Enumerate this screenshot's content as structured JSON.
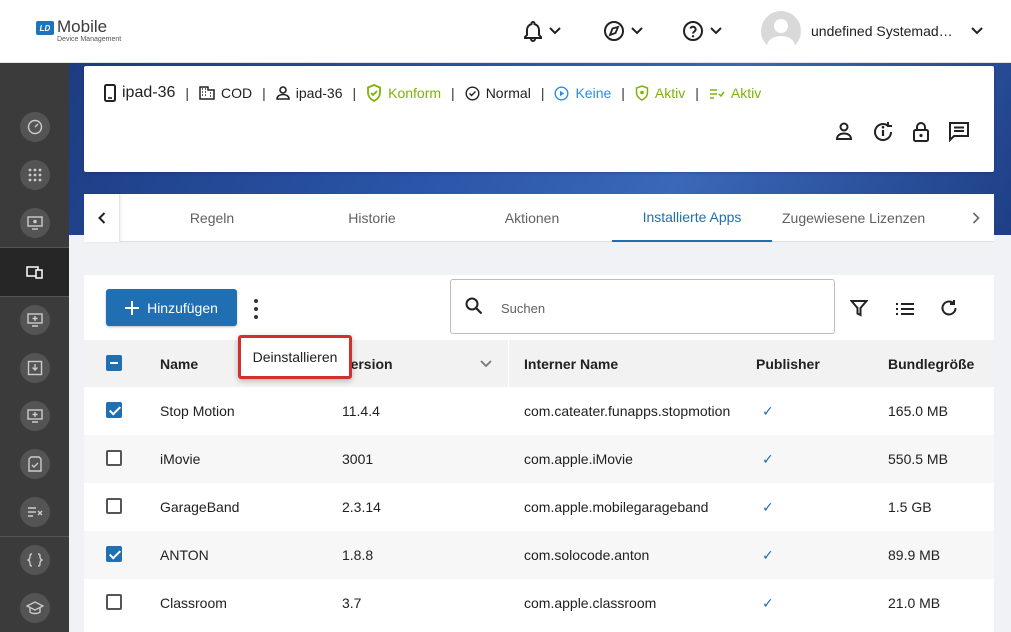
{
  "app": {
    "logo_badge": "LD",
    "logo_main": "Mobile",
    "logo_sub": "Device Management"
  },
  "header": {
    "user_name": "undefined Systemadmini",
    "icons": [
      "bell-icon",
      "compass-icon",
      "help-icon"
    ]
  },
  "device": {
    "name": "ipad-36",
    "location": "COD",
    "user": "ipad-36",
    "compliance": "Konform",
    "mode": "Normal",
    "action": "Keine",
    "security": "Aktiv",
    "policy": "Aktiv"
  },
  "tabs": [
    {
      "label": "Regeln"
    },
    {
      "label": "Historie"
    },
    {
      "label": "Aktionen"
    },
    {
      "label": "Installierte Apps"
    },
    {
      "label": "Zugewiesene Lizenzen"
    }
  ],
  "toolbar": {
    "add_label": "Hinzufügen",
    "search_placeholder": "Suchen"
  },
  "menu": {
    "uninstall_label": "Deinstallieren"
  },
  "table": {
    "columns": [
      "Name",
      "Version",
      "Interner Name",
      "Publisher",
      "Bundlegröße"
    ],
    "rows": [
      {
        "checked": true,
        "name": "Stop Motion",
        "version": "11.4.4",
        "internal": "com.cateater.funapps.stopmotion",
        "publisher": "✓",
        "size": "165.0 MB"
      },
      {
        "checked": false,
        "name": "iMovie",
        "version": "3001",
        "internal": "com.apple.iMovie",
        "publisher": "✓",
        "size": "550.5 MB"
      },
      {
        "checked": false,
        "name": "GarageBand",
        "version": "2.3.14",
        "internal": "com.apple.mobilegarageband",
        "publisher": "✓",
        "size": "1.5 GB"
      },
      {
        "checked": true,
        "name": "ANTON",
        "version": "1.8.8",
        "internal": "com.solocode.anton",
        "publisher": "✓",
        "size": "89.9 MB"
      },
      {
        "checked": false,
        "name": "Classroom",
        "version": "3.7",
        "internal": "com.apple.classroom",
        "publisher": "✓",
        "size": "21.0 MB"
      }
    ]
  },
  "colors": {
    "primary": "#1f6fb2",
    "success": "#7cb305",
    "info": "#2d8be6",
    "highlight": "#d32f2f",
    "sidebar": "#3b3b3b"
  }
}
